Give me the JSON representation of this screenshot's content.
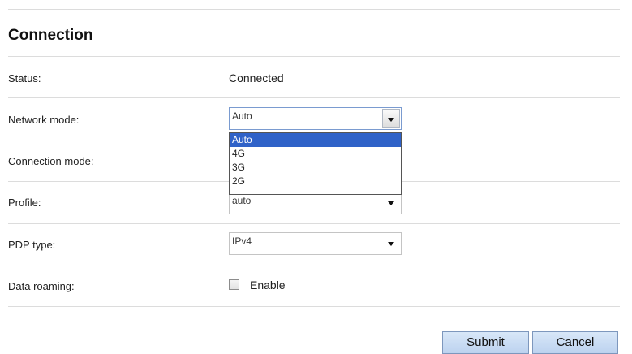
{
  "section_title": "Connection",
  "fields": {
    "status": {
      "label": "Status:",
      "value": "Connected"
    },
    "network_mode": {
      "label": "Network mode:",
      "selected": "Auto",
      "options": [
        "Auto",
        "4G",
        "3G",
        "2G"
      ]
    },
    "connection_mode": {
      "label": "Connection mode:"
    },
    "profile": {
      "label": "Profile:",
      "selected": "auto"
    },
    "pdp_type": {
      "label": "PDP type:",
      "selected": "IPv4"
    },
    "data_roaming": {
      "label": "Data roaming:",
      "checkbox_label": "Enable",
      "checked": false
    }
  },
  "buttons": {
    "submit": "Submit",
    "cancel": "Cancel"
  },
  "colors": {
    "highlight": "#2f62c8",
    "button_bg": "#c9dcf3"
  }
}
